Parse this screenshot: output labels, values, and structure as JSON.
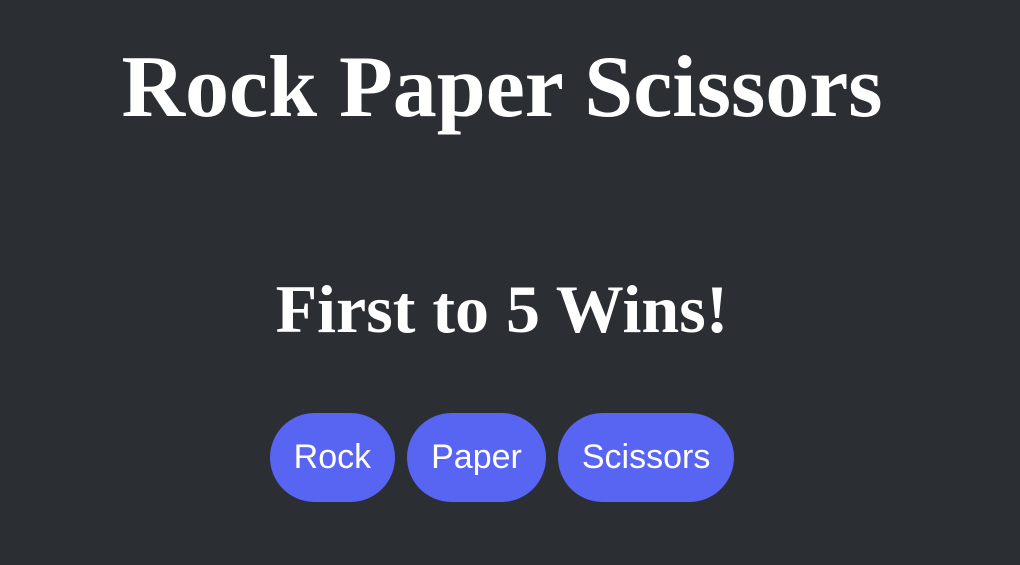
{
  "header": {
    "title": "Rock Paper Scissors"
  },
  "main": {
    "goal": "First to 5 Wins!",
    "choices": [
      {
        "label": "Rock"
      },
      {
        "label": "Paper"
      },
      {
        "label": "Scissors"
      }
    ]
  },
  "colors": {
    "background": "#2b2e33",
    "button": "#5865f2",
    "text": "#ffffff"
  }
}
